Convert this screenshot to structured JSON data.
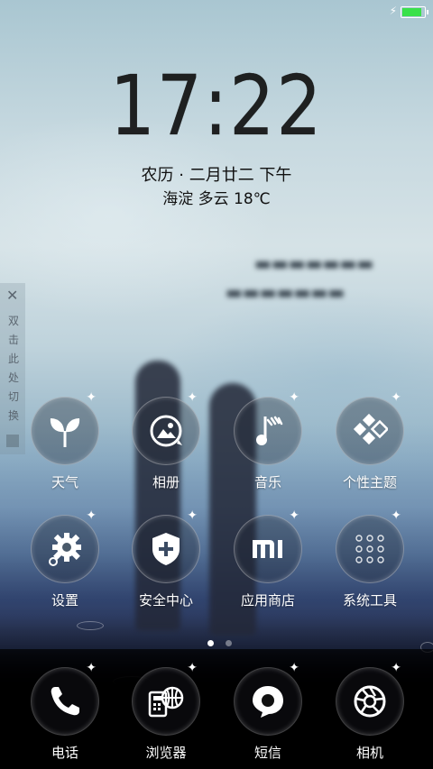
{
  "status_bar": {
    "charging_icon": "bolt-icon",
    "battery_color": "#39e14a"
  },
  "lockscreen": {
    "time": "17:22",
    "lunar_date": "农历 · 二月廿二  下午",
    "weather": "海淀  多云  18℃"
  },
  "side_tab": {
    "close": "✕",
    "text": "双击此处切换"
  },
  "apps": [
    {
      "name": "天气",
      "icon": "sprout-icon"
    },
    {
      "name": "相册",
      "icon": "photo-icon"
    },
    {
      "name": "音乐",
      "icon": "music-note-icon"
    },
    {
      "name": "个性主题",
      "icon": "theme-diamond-icon"
    },
    {
      "name": "设置",
      "icon": "gear-icon"
    },
    {
      "name": "安全中心",
      "icon": "shield-plus-icon"
    },
    {
      "name": "应用商店",
      "icon": "mi-logo-icon"
    },
    {
      "name": "系统工具",
      "icon": "folder-grid-icon"
    }
  ],
  "page_indicator": {
    "current": 1,
    "total": 2
  },
  "dock": [
    {
      "name": "电话",
      "icon": "phone-icon"
    },
    {
      "name": "浏览器",
      "icon": "browser-icon"
    },
    {
      "name": "短信",
      "icon": "message-icon"
    },
    {
      "name": "相机",
      "icon": "camera-lens-icon"
    }
  ]
}
